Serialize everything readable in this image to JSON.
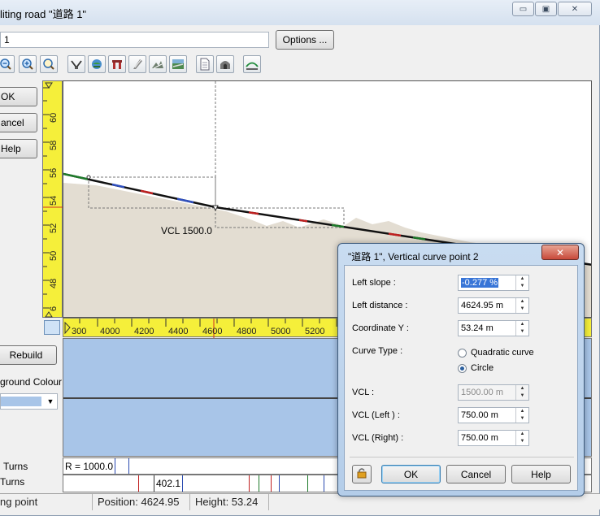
{
  "window": {
    "title": "liting road \"道路 1\"",
    "caption": {
      "minimize": "▭",
      "maximize": "▣",
      "close": "✕"
    }
  },
  "header": {
    "name_value": "1",
    "options_label": "Options ..."
  },
  "toolbar": {
    "icons": [
      "zoom-out-icon",
      "zoom-in-icon",
      "zoom-fit-icon",
      "cross-section-icon",
      "globe-icon",
      "bridge-icon",
      "road-icon",
      "terrain-icon",
      "landscape-icon",
      "document-icon",
      "tunnel-icon",
      "curve-icon"
    ]
  },
  "side": {
    "ok_label": "OK",
    "cancel_label": "ancel",
    "help_label": "Help",
    "rebuild_label": "Rebuild",
    "bg_colour_label": "ground Colour:",
    "colour_value": "#a8c5e8"
  },
  "profile": {
    "vcl_label": "VCL  1500.0",
    "y_ticks": [
      "6",
      "48",
      "50",
      "52",
      "54",
      "56",
      "58",
      "60"
    ],
    "x_ticks": [
      "300",
      "4000",
      "4200",
      "4400",
      "4600",
      "4800",
      "5000",
      "5200"
    ]
  },
  "turns": {
    "label1": "Turns",
    "label2": "Turns",
    "radius": "R = 1000.0",
    "distance": "402.1"
  },
  "status": {
    "mode": "ng point",
    "position": "Position: 4624.95",
    "height": "Height: 53.24"
  },
  "dialog": {
    "title": "\"道路 1\", Vertical curve point 2",
    "left_slope_label": "Left slope :",
    "left_slope_value": "-0.277 %",
    "left_distance_label": "Left distance :",
    "left_distance_value": "4624.95 m",
    "coord_y_label": "Coordinate Y :",
    "coord_y_value": "53.24 m",
    "curve_type_label": "Curve Type :",
    "quadratic_label": "Quadratic curve",
    "circle_label": "Circle",
    "vcl_label": "VCL :",
    "vcl_value": "1500.00 m",
    "vcl_left_label": "VCL (Left ) :",
    "vcl_left_value": "750.00 m",
    "vcl_right_label": "VCL (Right) :",
    "vcl_right_value": "750.00 m",
    "ok_label": "OK",
    "cancel_label": "Cancel",
    "help_label": "Help",
    "close_label": "✕"
  }
}
